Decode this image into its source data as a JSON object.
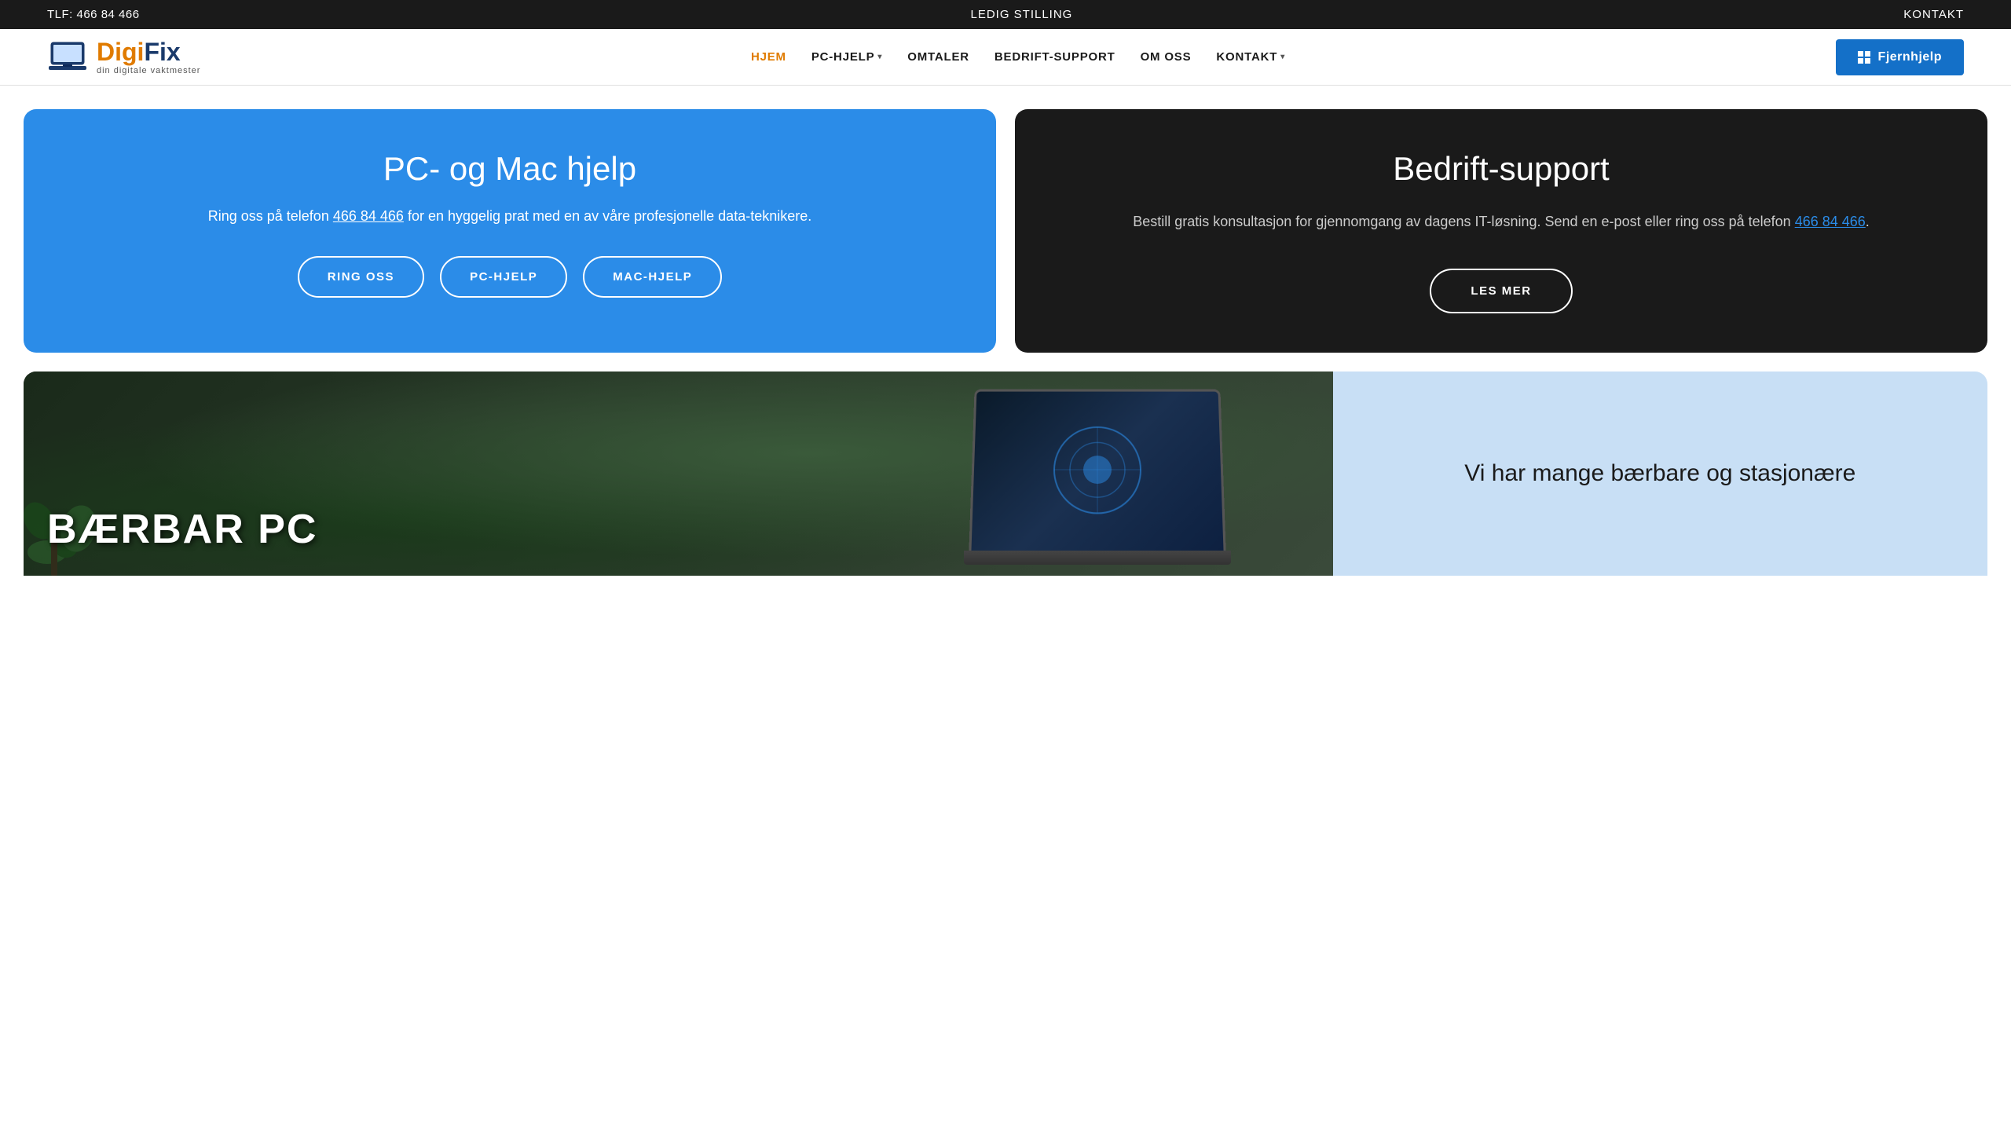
{
  "topbar": {
    "phone_label": "TLF: 466 84 466",
    "job_label": "LEDIG STILLING",
    "contact_label": "KONTAKT"
  },
  "header": {
    "logo_main_prefix": "Digi",
    "logo_main_suffix": "Fix",
    "logo_tagline": "din digitale vaktmester",
    "nav": [
      {
        "label": "HJEM",
        "active": true,
        "has_dropdown": false
      },
      {
        "label": "PC-HJELP",
        "active": false,
        "has_dropdown": true
      },
      {
        "label": "OMTALER",
        "active": false,
        "has_dropdown": false
      },
      {
        "label": "BEDRIFT-SUPPORT",
        "active": false,
        "has_dropdown": false
      },
      {
        "label": "OM OSS",
        "active": false,
        "has_dropdown": false
      },
      {
        "label": "KONTAKT",
        "active": false,
        "has_dropdown": true
      }
    ],
    "fjernhjelp_label": "Fjernhjelp"
  },
  "hero_blue": {
    "title": "PC- og Mac hjelp",
    "description_prefix": "Ring oss på telefon ",
    "phone": "466 84 466",
    "description_suffix": " for en hyggelig prat med en av våre profesjonelle data-teknikere.",
    "buttons": [
      {
        "label": "RING OSS"
      },
      {
        "label": "PC-HJELP"
      },
      {
        "label": "MAC-HJELP"
      }
    ]
  },
  "hero_dark": {
    "title": "Bedrift-support",
    "description": "Bestill gratis konsultasjon for gjennomgang av dagens IT-løsning. Send en e-post eller ring oss på telefon ",
    "phone": "466 84 466",
    "description_suffix": ".",
    "button_label": "LES MER"
  },
  "bottom_left": {
    "title_line1": "BÆRBAR PC"
  },
  "bottom_right": {
    "text": "Vi har mange bærbare og stasjonære"
  }
}
